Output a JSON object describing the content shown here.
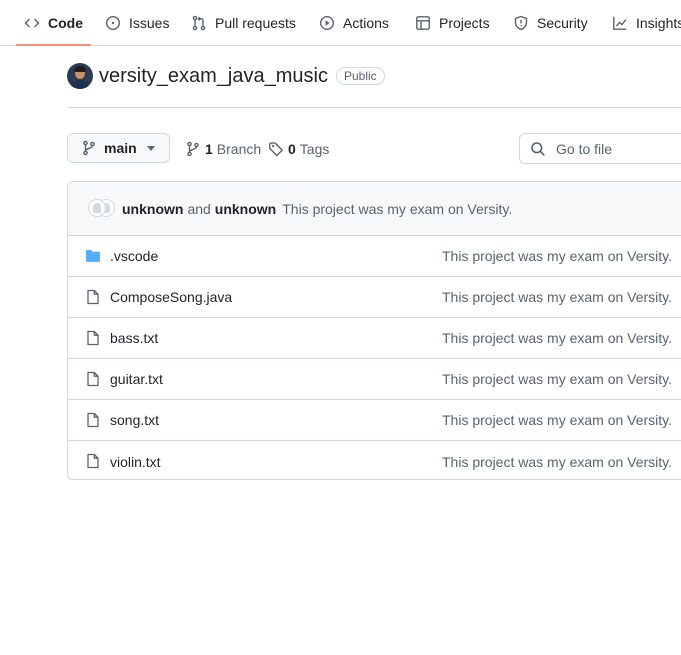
{
  "nav": {
    "tabs": [
      {
        "label": "Code",
        "icon": "code-icon",
        "selected": true
      },
      {
        "label": "Issues",
        "icon": "issue-opened-icon"
      },
      {
        "label": "Pull requests",
        "icon": "git-pull-request-icon"
      },
      {
        "label": "Actions",
        "icon": "play-icon"
      },
      {
        "label": "Projects",
        "icon": "table-icon"
      },
      {
        "label": "Security",
        "icon": "shield-icon"
      },
      {
        "label": "Insights",
        "icon": "graph-icon"
      }
    ]
  },
  "repo": {
    "name": "versity_exam_java_music",
    "visibility": "Public"
  },
  "toolbar": {
    "branch": "main",
    "branch_count": "1",
    "branch_label": "Branch",
    "tag_count": "0",
    "tag_label": "Tags",
    "search_placeholder": "Go to file"
  },
  "commit": {
    "author1": "unknown",
    "and": "and",
    "author2": "unknown",
    "message": "This project was my exam on Versity."
  },
  "files": [
    {
      "name": ".vscode",
      "type": "folder",
      "message": "This project was my exam on Versity."
    },
    {
      "name": "ComposeSong.java",
      "type": "file",
      "message": "This project was my exam on Versity."
    },
    {
      "name": "bass.txt",
      "type": "file",
      "message": "This project was my exam on Versity."
    },
    {
      "name": "guitar.txt",
      "type": "file",
      "message": "This project was my exam on Versity."
    },
    {
      "name": "song.txt",
      "type": "file",
      "message": "This project was my exam on Versity."
    },
    {
      "name": "violin.txt",
      "type": "file",
      "message": "This project was my exam on Versity."
    }
  ],
  "colors": {
    "accent_underline": "#fd8c73",
    "folder": "#54aeff",
    "border": "#d1d9e0",
    "muted_text": "#59636e"
  }
}
